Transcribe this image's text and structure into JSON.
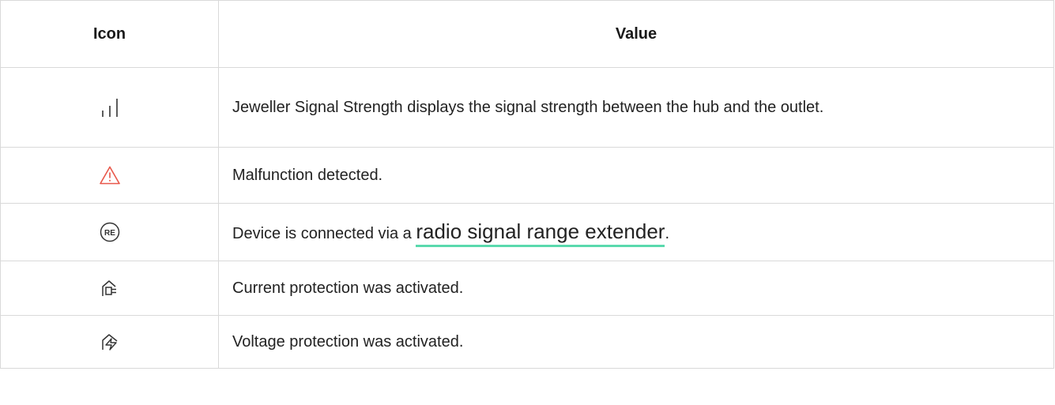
{
  "table": {
    "headers": {
      "icon": "Icon",
      "value": "Value"
    },
    "rows": [
      {
        "icon": "signal-strength-icon",
        "text": "Jeweller Signal Strength displays the signal strength between the hub and the outlet."
      },
      {
        "icon": "warning-triangle-icon",
        "icon_color": "#e8574a",
        "text": "Malfunction detected."
      },
      {
        "icon": "range-extender-re-icon",
        "icon_label": "RE",
        "text_before": "Device is connected via a ",
        "link_text": "radio signal range extender",
        "text_after": "."
      },
      {
        "icon": "current-protection-icon",
        "text": "Current protection was activated."
      },
      {
        "icon": "voltage-protection-icon",
        "text": "Voltage protection was activated."
      }
    ]
  },
  "colors": {
    "border": "#d9d9d9",
    "link_underline": "#5ad9ad",
    "warning": "#e8574a"
  }
}
